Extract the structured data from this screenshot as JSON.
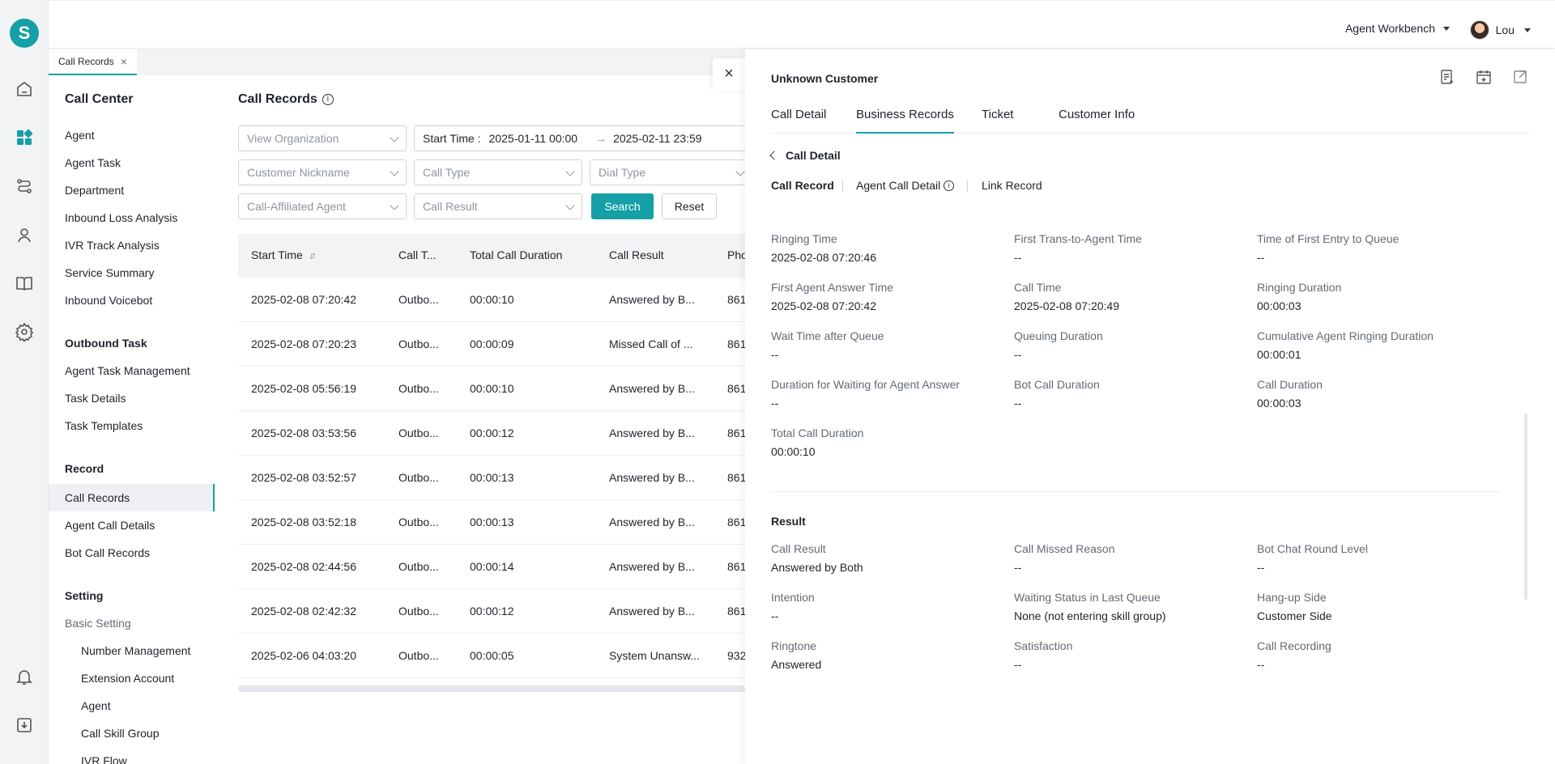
{
  "topbar": {
    "workbench": "Agent Workbench",
    "user": "Lou"
  },
  "logo": "S",
  "tabs": [
    {
      "label": "Call Records"
    }
  ],
  "menu": {
    "title": "Call Center",
    "items_top": [
      "Agent",
      "Agent Task",
      "Department",
      "Inbound Loss Analysis",
      "IVR Track Analysis",
      "Service Summary",
      "Inbound Voicebot"
    ],
    "group_outbound": "Outbound Task",
    "items_outbound": [
      "Agent Task Management",
      "Task Details",
      "Task Templates"
    ],
    "group_record": "Record",
    "items_record": [
      "Call Records",
      "Agent Call Details",
      "Bot Call Records"
    ],
    "group_setting": "Setting",
    "subgroup_basic": "Basic Setting",
    "items_basic": [
      "Number Management",
      "Extension Account",
      "Agent",
      "Call Skill Group",
      "IVR Flow"
    ]
  },
  "main": {
    "title": "Call Records",
    "filters": {
      "view_org": "View Organization",
      "start_time_label": "Start Time :",
      "start_from": "2025-01-11 00:00",
      "arrow": "→",
      "start_to": "2025-02-11 23:59",
      "customer_nickname": "Customer Nickname",
      "call_type": "Call Type",
      "dial_type": "Dial Type",
      "affiliated_agent": "Call-Affiliated Agent",
      "call_result": "Call Result",
      "search": "Search",
      "reset": "Reset"
    },
    "columns": [
      "Start Time",
      "Call T...",
      "Total Call Duration",
      "Call Result",
      "Pho"
    ],
    "rows": [
      [
        "2025-02-08 07:20:42",
        "Outbo...",
        "00:00:10",
        "Answered by B...",
        "861"
      ],
      [
        "2025-02-08 07:20:23",
        "Outbo...",
        "00:00:09",
        "Missed Call of ...",
        "861"
      ],
      [
        "2025-02-08 05:56:19",
        "Outbo...",
        "00:00:10",
        "Answered by B...",
        "861"
      ],
      [
        "2025-02-08 03:53:56",
        "Outbo...",
        "00:00:12",
        "Answered by B...",
        "861"
      ],
      [
        "2025-02-08 03:52:57",
        "Outbo...",
        "00:00:13",
        "Answered by B...",
        "861"
      ],
      [
        "2025-02-08 03:52:18",
        "Outbo...",
        "00:00:13",
        "Answered by B...",
        "861"
      ],
      [
        "2025-02-08 02:44:56",
        "Outbo...",
        "00:00:14",
        "Answered by B...",
        "861"
      ],
      [
        "2025-02-08 02:42:32",
        "Outbo...",
        "00:00:12",
        "Answered by B...",
        "861"
      ],
      [
        "2025-02-06 04:03:20",
        "Outbo...",
        "00:00:05",
        "System Unansw...",
        "932"
      ]
    ]
  },
  "drawer": {
    "customer": "Unknown Customer",
    "tabs": [
      "Call Detail",
      "Business Records",
      "Ticket",
      "Customer Info"
    ],
    "back_label": "Call Detail",
    "subtabs": [
      "Call Record",
      "Agent Call Detail",
      "Link Record"
    ],
    "details": [
      {
        "k": "Ringing Time",
        "v": "2025-02-08 07:20:46"
      },
      {
        "k": "First Trans-to-Agent Time",
        "v": "--"
      },
      {
        "k": "Time of First Entry to Queue",
        "v": "--"
      },
      {
        "k": "First Agent Answer Time",
        "v": "2025-02-08 07:20:42"
      },
      {
        "k": "Call Time",
        "v": "2025-02-08 07:20:49"
      },
      {
        "k": "Ringing Duration",
        "v": "00:00:03"
      },
      {
        "k": "Wait Time after Queue",
        "v": "--"
      },
      {
        "k": "Queuing Duration",
        "v": "--"
      },
      {
        "k": "Cumulative Agent Ringing Duration",
        "v": "00:00:01"
      },
      {
        "k": "Duration for Waiting for Agent Answer",
        "v": "--"
      },
      {
        "k": "Bot Call Duration",
        "v": "--"
      },
      {
        "k": "Call Duration",
        "v": "00:00:03"
      },
      {
        "k": "Total Call Duration",
        "v": "00:00:10"
      }
    ],
    "result_title": "Result",
    "results": [
      {
        "k": "Call Result",
        "v": "Answered by Both"
      },
      {
        "k": "Call Missed Reason",
        "v": "--"
      },
      {
        "k": "Bot Chat Round Level",
        "v": "--"
      },
      {
        "k": "Intention",
        "v": "--"
      },
      {
        "k": "Waiting Status in Last Queue",
        "v": "None (not entering skill group)"
      },
      {
        "k": "Hang-up Side",
        "v": "Customer Side"
      },
      {
        "k": "Ringtone",
        "v": "Answered"
      },
      {
        "k": "Satisfaction",
        "v": "--"
      },
      {
        "k": "Call Recording",
        "v": "--"
      }
    ]
  },
  "colors": {
    "accent": "#14a0a6"
  }
}
